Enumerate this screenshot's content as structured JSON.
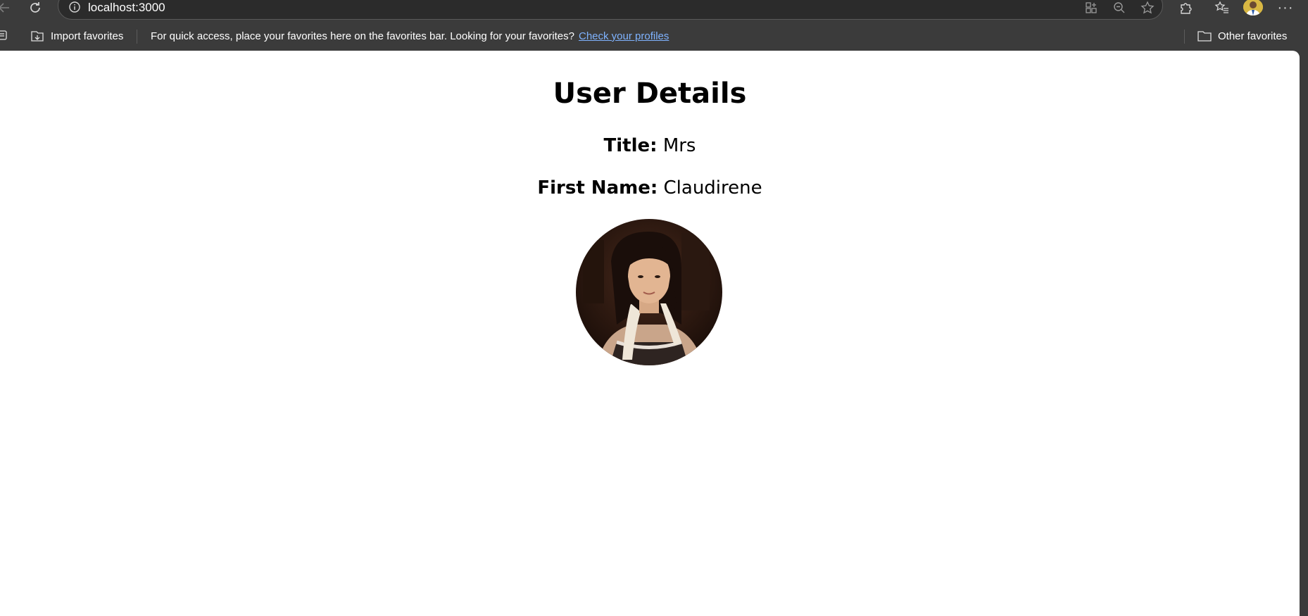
{
  "browser": {
    "url": "localhost:3000",
    "icons": [
      "back-icon",
      "refresh-icon",
      "info-icon",
      "apps-icon",
      "zoom-out-icon",
      "star-icon",
      "extensions-icon",
      "favorites-icon",
      "profile-avatar",
      "more-icon"
    ]
  },
  "favorites_bar": {
    "import_label": "Import favorites",
    "message": "For quick access, place your favorites here on the favorites bar. Looking for your favorites?",
    "link_text": "Check your profiles",
    "other_label": "Other favorites"
  },
  "page": {
    "heading": "User Details",
    "title_label": "Title:",
    "title_value": "Mrs",
    "first_name_label": "First Name:",
    "first_name_value": "Claudirene"
  },
  "colors": {
    "browser_chrome": "#3b3b3b",
    "link": "#7fb3ff",
    "page_background": "#ffffff"
  }
}
